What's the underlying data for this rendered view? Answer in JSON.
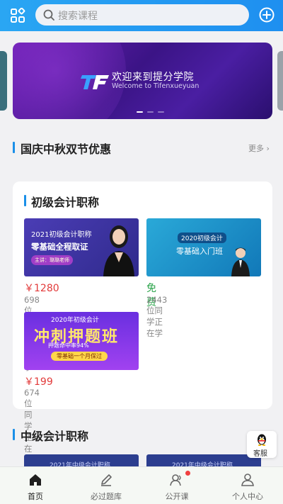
{
  "header": {
    "search_placeholder": "搜索课程",
    "left_icon": "grid-apps-icon",
    "right_icon": "plus-circle-icon"
  },
  "banner": {
    "title": "欢迎来到提分学院",
    "subtitle": "Welcome to Tifenxueyuan",
    "logo_text": "TF",
    "dots_total": 3,
    "dots_active": 1
  },
  "promo_section": {
    "title": "国庆中秋双节优惠",
    "more": "更多"
  },
  "card": {
    "title": "初级会计职称",
    "courses": [
      {
        "thumb_line1": "2021初级会计职称",
        "thumb_line2": "零基础全程取证",
        "thumb_line3": "主讲：璐璐老师",
        "price": "￥1280",
        "learners": "698位同学正在学"
      },
      {
        "thumb_line1": "2020初级会计",
        "thumb_line2": "零基础入门班",
        "price": "免费",
        "learners": "2443位同学正在学"
      },
      {
        "thumb_line1": "2020年初级会计",
        "thumb_line2": "冲刺押题班",
        "thumb_line3": "押题命中率94%",
        "thumb_line4": "零基础一个月保过",
        "price": "￥199",
        "learners": "674位同学正在学"
      }
    ]
  },
  "section2": {
    "title": "中级会计职称",
    "strip_text": "2021年中级会计职称"
  },
  "float_button": {
    "label": "客服",
    "icon": "qq-penguin-icon"
  },
  "tabs": [
    {
      "label": "首页",
      "icon": "home-icon",
      "active": true
    },
    {
      "label": "必过题库",
      "icon": "pencil-icon",
      "active": false
    },
    {
      "label": "公开课",
      "icon": "open-class-icon",
      "active": false,
      "badge": true
    },
    {
      "label": "个人中心",
      "icon": "user-icon",
      "active": false
    }
  ],
  "colors": {
    "header": "#1e8ff0",
    "accent": "#1a8fe8",
    "price": "#e23a3a",
    "free": "#2aa34a"
  }
}
